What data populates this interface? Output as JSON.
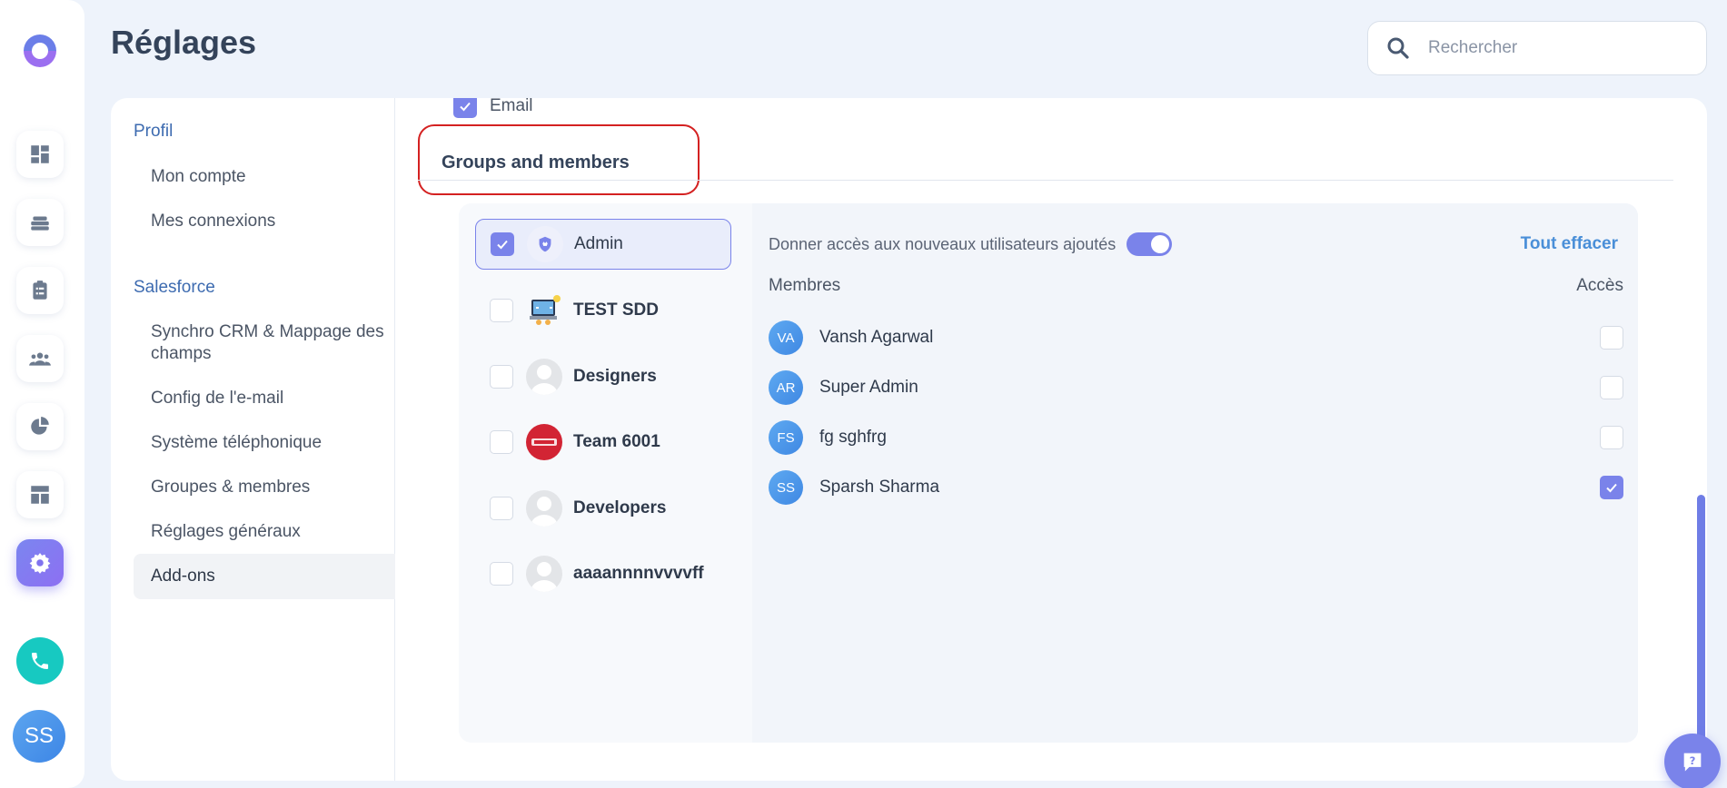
{
  "header": {
    "title": "Réglages",
    "search_placeholder": "Rechercher"
  },
  "rail": {
    "items": [
      "dashboard-icon",
      "layers-icon",
      "clipboard-icon",
      "team-icon",
      "pie-chart-icon",
      "layout-icon",
      "settings-icon"
    ],
    "active": "settings-icon",
    "user_initials": "SS"
  },
  "side_menu": {
    "profil": {
      "title": "Profil",
      "items": [
        "Mon compte",
        "Mes connexions"
      ]
    },
    "salesforce": {
      "title": "Salesforce",
      "items": [
        "Synchro CRM & Mappage des champs",
        "Config de l'e-mail",
        "Système téléphonique",
        "Groupes & membres",
        "Réglages généraux",
        "Add-ons"
      ]
    },
    "active": "Add-ons"
  },
  "content": {
    "email_label": "Email",
    "section_title": "Groups and members",
    "groups": [
      {
        "name": "Admin",
        "checked": true,
        "selected": true
      },
      {
        "name": "TEST SDD",
        "checked": false
      },
      {
        "name": "Designers",
        "checked": false
      },
      {
        "name": "Team 6001",
        "checked": false
      },
      {
        "name": "Developers",
        "checked": false
      },
      {
        "name": "aaaannnnvvvvff",
        "checked": false
      }
    ],
    "access_toggle_label": "Donner accès aux nouveaux utilisateurs ajoutés",
    "access_toggle_on": true,
    "clear_all": "Tout effacer",
    "members_header": "Membres",
    "access_header": "Accès",
    "members": [
      {
        "initials": "VA",
        "name": "Vansh Agarwal",
        "access": false
      },
      {
        "initials": "AR",
        "name": "Super Admin",
        "access": false
      },
      {
        "initials": "FS",
        "name": "fg sghfrg",
        "access": false
      },
      {
        "initials": "SS",
        "name": "Sparsh Sharma",
        "access": true
      }
    ]
  },
  "colors": {
    "accent": "#7a83ea",
    "link": "#4a8fd8",
    "highlight_border": "#d42121",
    "phone": "#17c9c1"
  }
}
